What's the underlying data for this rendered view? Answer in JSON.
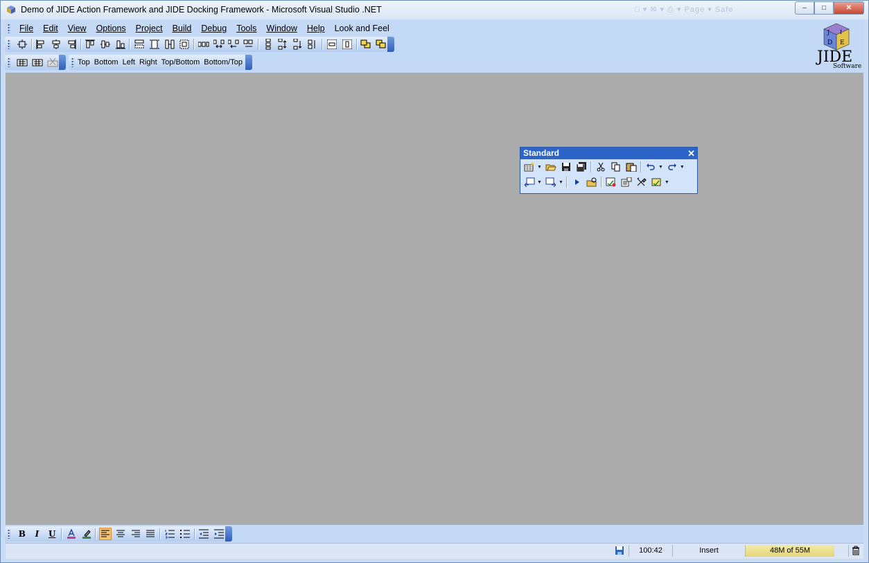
{
  "window": {
    "title": "Demo of JIDE Action Framework and JIDE Docking Framework - Microsoft Visual Studio .NET",
    "faded_titlebar_text": "□ ▾ ✉ ▾ ⎙ ▾ Page ▾ Safe",
    "caption_buttons": {
      "minimize": "–",
      "maximize": "□",
      "close": "✕"
    }
  },
  "menubar": {
    "items": [
      {
        "label": "File",
        "key": "file"
      },
      {
        "label": "Edit",
        "key": "edit"
      },
      {
        "label": "View",
        "key": "view"
      },
      {
        "label": "Options",
        "key": "options"
      },
      {
        "label": "Project",
        "key": "project"
      },
      {
        "label": "Build",
        "key": "build"
      },
      {
        "label": "Debug",
        "key": "debug"
      },
      {
        "label": "Tools",
        "key": "tools"
      },
      {
        "label": "Window",
        "key": "window"
      },
      {
        "label": "Help",
        "key": "help"
      },
      {
        "label": "Look and Feel",
        "key": "lookandfeel"
      }
    ]
  },
  "layout_toolbar": {
    "icons": [
      "align-to-grid-icon",
      "align-left-icon",
      "align-center-icon",
      "align-right-icon",
      "align-top-icon",
      "align-middle-icon",
      "align-bottom-icon",
      "make-same-width-icon",
      "make-same-height-icon",
      "make-same-size-icon",
      "size-to-grid-icon",
      "horizontal-spacing-equal-icon",
      "increase-horizontal-spacing-icon",
      "decrease-horizontal-spacing-icon",
      "remove-horizontal-spacing-icon",
      "vertical-spacing-equal-icon",
      "increase-vertical-spacing-icon",
      "decrease-vertical-spacing-icon",
      "remove-vertical-spacing-icon",
      "center-horizontally-icon",
      "center-vertically-icon",
      "bring-to-front-icon",
      "send-to-back-icon"
    ]
  },
  "tabs_toolbar": {
    "icons": [
      "tab-order-icon",
      "tab-strip-icon",
      "tab-disabled-icon"
    ],
    "labels": [
      "Top",
      "Bottom",
      "Left",
      "Right",
      "Top/Bottom",
      "Bottom/Top"
    ]
  },
  "logo": {
    "line1": "JIDE",
    "line2": "Software",
    "cube_letters": [
      "J",
      "I",
      "D",
      "E"
    ]
  },
  "standard_toolbar": {
    "title": "Standard",
    "close_glyph": "✕",
    "row1": [
      "new-project-icon",
      "open-file-icon",
      "save-icon",
      "save-all-icon",
      "cut-icon",
      "copy-icon",
      "paste-icon",
      "undo-icon",
      "redo-icon"
    ],
    "row2": [
      "navigate-backward-icon",
      "navigate-forward-icon",
      "start-icon",
      "find-in-files-icon",
      "solution-explorer-icon",
      "properties-icon",
      "toolbox-icon",
      "class-view-icon"
    ]
  },
  "format_toolbar": {
    "bold": "B",
    "italic": "I",
    "underline": "U",
    "icons": [
      "font-color-icon",
      "highlight-icon",
      "align-left-icon",
      "align-center-icon",
      "align-right-icon",
      "justify-icon",
      "numbered-list-icon",
      "bullet-list-icon",
      "decrease-indent-icon",
      "increase-indent-icon"
    ]
  },
  "statusbar": {
    "position": "100:42",
    "mode": "Insert",
    "memory": "48M of 55M"
  },
  "colors": {
    "title_gradient_top": "#eef4fb",
    "command_area": "#c4d9f5",
    "client_area": "#ababab",
    "float_title": "#2d64c8",
    "memory_bar": "#e4d57a",
    "toolbar_endcap": "#2f5eb8"
  }
}
